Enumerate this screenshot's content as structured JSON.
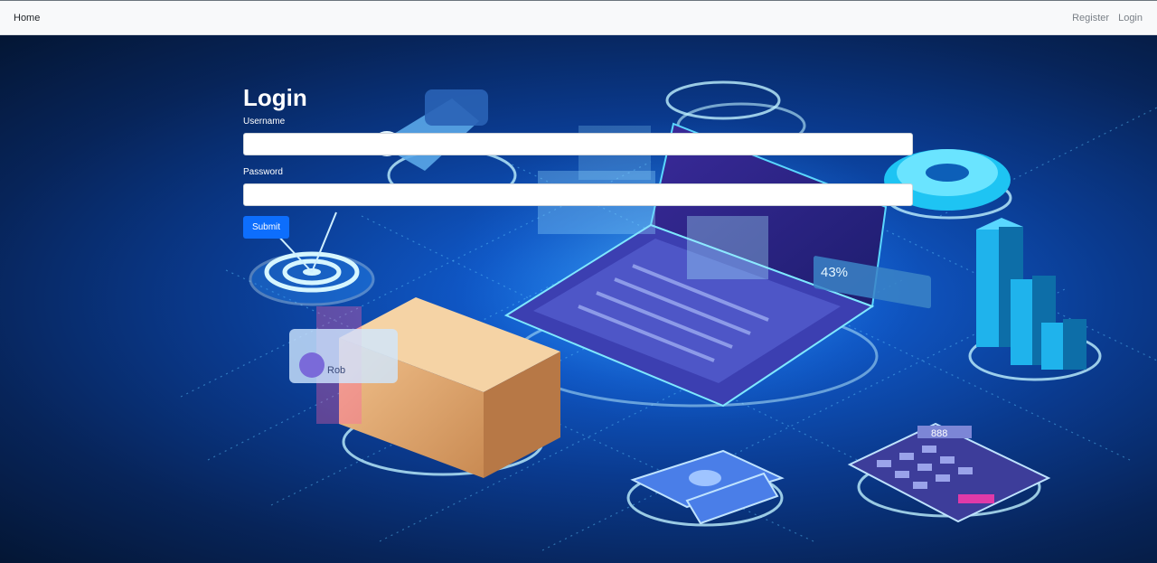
{
  "navbar": {
    "brand": "Home",
    "links": [
      {
        "label": "Register"
      },
      {
        "label": "Login"
      }
    ]
  },
  "form": {
    "title": "Login",
    "username_label": "Username",
    "username_value": "",
    "password_label": "Password",
    "password_value": "",
    "submit_label": "Submit"
  },
  "illustration": {
    "laptop_stat": "43%",
    "calculator_display": "888",
    "profile_name": "Rob"
  },
  "colors": {
    "navbar_bg": "#f8f9fa",
    "accent": "#0d6efd",
    "hero_bg": "#0a3a8e"
  }
}
